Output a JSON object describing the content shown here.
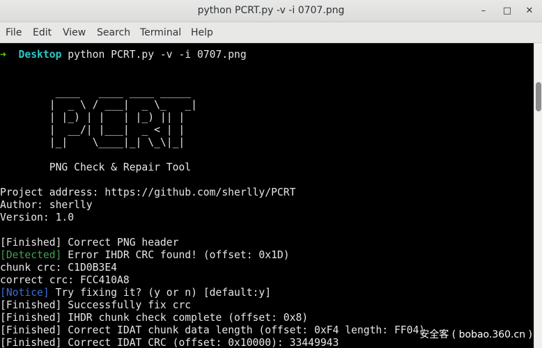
{
  "window": {
    "title": "python PCRT.py -v -i 0707.png",
    "minimize_glyph": "–",
    "maximize_glyph": "□",
    "close_glyph": "✕"
  },
  "menu": [
    "File",
    "Edit",
    "View",
    "Search",
    "Terminal",
    "Help"
  ],
  "prompt": {
    "arrow": "➜",
    "dir": "Desktop",
    "command": "python PCRT.py -v -i 0707.png"
  },
  "banner": [
    "         ____   ____ ____ _____ ",
    "        |  _ \\ / ___|  _ \\_   _|",
    "        | |_) | |   | |_) || |  ",
    "        |  __/| |___|  _ < | |  ",
    "        |_|    \\____|_| \\_\\|_|  "
  ],
  "tool_name": "        PNG Check & Repair Tool",
  "info": [
    "Project address: https://github.com/sherlly/PCRT",
    "Author: sherlly",
    "Version: 1.0"
  ],
  "log": [
    {
      "tag": "[Finished]",
      "style": "",
      "text": " Correct PNG header"
    },
    {
      "tag": "[Detected]",
      "style": "det",
      "text": " Error IHDR CRC found! (offset: 0x1D)"
    },
    {
      "tag": "",
      "style": "",
      "text": "chunk crc: C1D0B3E4"
    },
    {
      "tag": "",
      "style": "",
      "text": "correct crc: FCC410A8"
    },
    {
      "tag": "[Notice]",
      "style": "notice",
      "text": " Try fixing it? (y or n) [default:y]"
    },
    {
      "tag": "[Finished]",
      "style": "",
      "text": " Successfully fix crc"
    },
    {
      "tag": "[Finished]",
      "style": "",
      "text": " IHDR chunk check complete (offset: 0x8)"
    },
    {
      "tag": "[Finished]",
      "style": "",
      "text": " Correct IDAT chunk data length (offset: 0xF4 length: FF04)"
    },
    {
      "tag": "[Finished]",
      "style": "",
      "text": " Correct IDAT CRC (offset: 0x10000): 33449943"
    }
  ],
  "watermark": "安全客 ( bobao.360.cn )"
}
